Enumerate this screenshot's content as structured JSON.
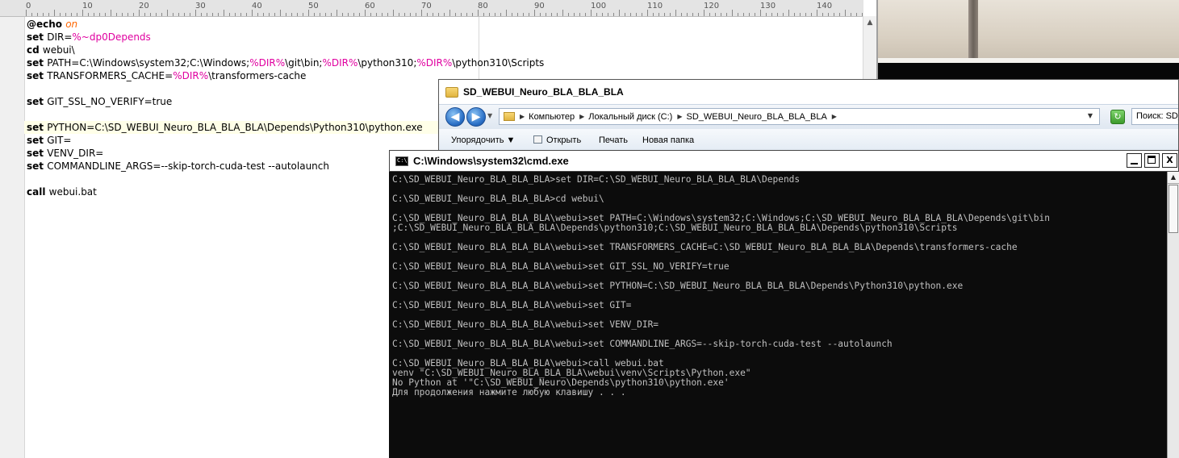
{
  "editor": {
    "ruler": [
      "0",
      "10",
      "20",
      "30",
      "40",
      "50",
      "60",
      "70",
      "80",
      "90",
      "100",
      "110",
      "120",
      "130",
      "140"
    ],
    "scroll_up": "▲",
    "lines": [
      [
        {
          "t": "@echo ",
          "c": "kw"
        },
        {
          "t": "on",
          "c": "on"
        }
      ],
      [
        {
          "t": "set ",
          "c": "kw"
        },
        {
          "t": "DIR="
        },
        {
          "t": "%~dp0Depends",
          "c": "var"
        }
      ],
      [
        {
          "t": "cd ",
          "c": "kw"
        },
        {
          "t": "webui\\"
        }
      ],
      [
        {
          "t": "set ",
          "c": "kw"
        },
        {
          "t": "PATH=C:\\Windows\\system32;C:\\Windows;"
        },
        {
          "t": "%DIR%",
          "c": "var"
        },
        {
          "t": "\\git\\bin;"
        },
        {
          "t": "%DIR%",
          "c": "var"
        },
        {
          "t": "\\python310;"
        },
        {
          "t": "%DIR%",
          "c": "var"
        },
        {
          "t": "\\python310\\Scripts"
        }
      ],
      [
        {
          "t": "set ",
          "c": "kw"
        },
        {
          "t": "TRANSFORMERS_CACHE="
        },
        {
          "t": "%DIR%",
          "c": "var"
        },
        {
          "t": "\\transformers-cache"
        }
      ],
      [],
      [
        {
          "t": "set ",
          "c": "kw"
        },
        {
          "t": "GIT_SSL_NO_VERIFY=true"
        }
      ],
      [],
      [
        {
          "t": "set ",
          "c": "kw"
        },
        {
          "t": "PYTHON=C:\\SD_WEBUI_Neuro_BLA_BLA_BLA\\Depends\\Python310\\python.exe"
        }
      ],
      [
        {
          "t": "set ",
          "c": "kw"
        },
        {
          "t": "GIT="
        }
      ],
      [
        {
          "t": "set ",
          "c": "kw"
        },
        {
          "t": "VENV_DIR="
        }
      ],
      [
        {
          "t": "set ",
          "c": "kw"
        },
        {
          "t": "COMMANDLINE_ARGS=--skip-torch-cuda-test --autolaunch"
        }
      ],
      [],
      [
        {
          "t": "call ",
          "c": "kw"
        },
        {
          "t": "webui.bat"
        }
      ]
    ],
    "current_line": 8
  },
  "explorer": {
    "title": "SD_WEBUI_Neuro_BLA_BLA_BLA",
    "back": "◀",
    "forward": "▶",
    "nav_dropdown": "▼",
    "breadcrumbs": [
      "Компьютер",
      "Локальный диск (C:)",
      "SD_WEBUI_Neuro_BLA_BLA_BLA"
    ],
    "crumb_sep": "▶",
    "addr_dropdown": "▼",
    "refresh": "↻",
    "search_placeholder": "Поиск: SD_WEBUI_Neuro_BLA_BLA_BLA",
    "toolbar": {
      "organize": "Упорядочить ▼",
      "open": "Открыть",
      "print": "Печать",
      "new_folder": "Новая папка"
    }
  },
  "cmd": {
    "title": "C:\\Windows\\system32\\cmd.exe",
    "icon_text": "C:\\",
    "close": "X",
    "scroll_up": "▲",
    "lines": [
      "C:\\SD_WEBUI_Neuro_BLA_BLA_BLA>set DIR=C:\\SD_WEBUI_Neuro_BLA_BLA_BLA\\Depends",
      "",
      "C:\\SD_WEBUI_Neuro_BLA_BLA_BLA>cd webui\\",
      "",
      "C:\\SD_WEBUI_Neuro_BLA_BLA_BLA\\webui>set PATH=C:\\Windows\\system32;C:\\Windows;C:\\SD_WEBUI_Neuro_BLA_BLA_BLA\\Depends\\git\\bin",
      ";C:\\SD_WEBUI_Neuro_BLA_BLA_BLA\\Depends\\python310;C:\\SD_WEBUI_Neuro_BLA_BLA_BLA\\Depends\\python310\\Scripts",
      "",
      "C:\\SD_WEBUI_Neuro_BLA_BLA_BLA\\webui>set TRANSFORMERS_CACHE=C:\\SD_WEBUI_Neuro_BLA_BLA_BLA\\Depends\\transformers-cache",
      "",
      "C:\\SD_WEBUI_Neuro_BLA_BLA_BLA\\webui>set GIT_SSL_NO_VERIFY=true",
      "",
      "C:\\SD_WEBUI_Neuro_BLA_BLA_BLA\\webui>set PYTHON=C:\\SD_WEBUI_Neuro_BLA_BLA_BLA\\Depends\\Python310\\python.exe",
      "",
      "C:\\SD_WEBUI_Neuro_BLA_BLA_BLA\\webui>set GIT=",
      "",
      "C:\\SD_WEBUI_Neuro_BLA_BLA_BLA\\webui>set VENV_DIR=",
      "",
      "C:\\SD_WEBUI_Neuro_BLA_BLA_BLA\\webui>set COMMANDLINE_ARGS=--skip-torch-cuda-test --autolaunch",
      "",
      "C:\\SD_WEBUI_Neuro_BLA_BLA_BLA\\webui>call webui.bat",
      "venv \"C:\\SD_WEBUI_Neuro_BLA_BLA_BLA\\webui\\venv\\Scripts\\Python.exe\"",
      "No Python at '\"C:\\SD_WEBUI_Neuro\\Depends\\python310\\python.exe'",
      "Для продолжения нажмите любую клавишу . . ."
    ]
  },
  "colors": {
    "editor_keyword": "#000000",
    "editor_variable": "#e000a0",
    "editor_echo_on": "#ff6600",
    "cmd_background": "#0c0c0c",
    "cmd_text": "#c0c0c0"
  }
}
